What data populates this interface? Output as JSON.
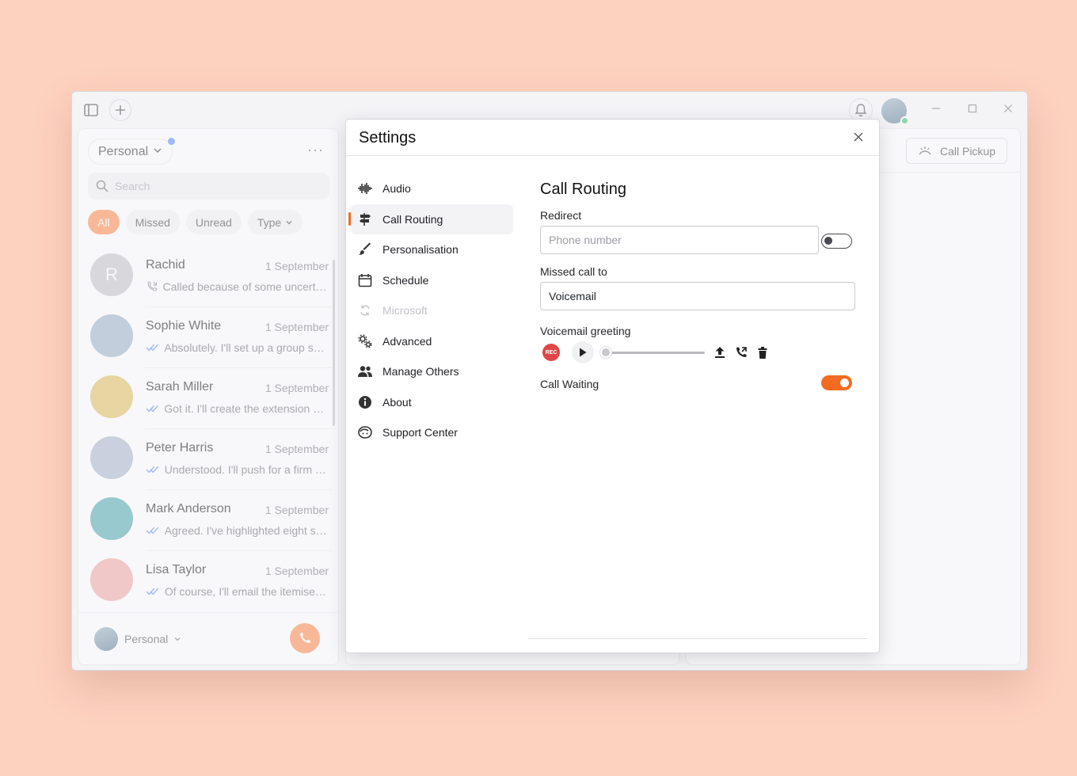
{
  "workspace": {
    "label": "Personal"
  },
  "search": {
    "placeholder": "Search"
  },
  "filters": [
    "All",
    "Missed",
    "Unread",
    "Type"
  ],
  "conversations": [
    {
      "name": "Rachid",
      "initial": "R",
      "date": "1 September",
      "preview": "Called because of some uncertai...",
      "preview_icon": "missed-call-icon",
      "avatar_color": "#c4c4c8"
    },
    {
      "name": "Sophie White",
      "date": "1 September",
      "preview": "Absolutely. I'll set up a group ses...",
      "preview_icon": "double-check-icon",
      "avatar_color": "#9fb3c8"
    },
    {
      "name": "Sarah Miller",
      "date": "1 September",
      "preview": "Got it. I'll create the extension an...",
      "preview_icon": "double-check-icon",
      "avatar_color": "#e0c060"
    },
    {
      "name": "Peter Harris",
      "date": "1 September",
      "preview": "Understood. I'll push for a firm p...",
      "preview_icon": "double-check-icon",
      "avatar_color": "#a9b8cc"
    },
    {
      "name": "Mark Anderson",
      "date": "1 September",
      "preview": "Agreed. I've highlighted eight se...",
      "preview_icon": "double-check-icon",
      "avatar_color": "#4faab0"
    },
    {
      "name": "Lisa Taylor",
      "date": "1 September",
      "preview": "Of course, I'll email the itemised...",
      "preview_icon": "double-check-icon",
      "avatar_color": "#f0a8a4"
    }
  ],
  "bottom": {
    "account_label": "Personal"
  },
  "right": {
    "call_pickup_label": "Call Pickup"
  },
  "settings": {
    "title": "Settings",
    "nav": [
      {
        "label": "Audio",
        "icon": "audio-wave-icon",
        "state": "normal"
      },
      {
        "label": "Call Routing",
        "icon": "signpost-icon",
        "state": "active"
      },
      {
        "label": "Personalisation",
        "icon": "brush-icon",
        "state": "normal"
      },
      {
        "label": "Schedule",
        "icon": "calendar-icon",
        "state": "normal"
      },
      {
        "label": "Microsoft",
        "icon": "sync-icon",
        "state": "disabled"
      },
      {
        "label": "Advanced",
        "icon": "gears-icon",
        "state": "normal"
      },
      {
        "label": "Manage Others",
        "icon": "people-icon",
        "state": "normal"
      },
      {
        "label": "About",
        "icon": "info-icon",
        "state": "normal"
      },
      {
        "label": "Support Center",
        "icon": "support-icon",
        "state": "normal"
      }
    ],
    "content": {
      "heading": "Call Routing",
      "redirect_label": "Redirect",
      "phone_placeholder": "Phone number",
      "redirect_enabled": false,
      "missed_call_label": "Missed call to",
      "missed_call_value": "Voicemail",
      "voicemail_label": "Voicemail greeting",
      "rec_label": "REC",
      "call_waiting_label": "Call Waiting",
      "call_waiting_enabled": true
    }
  },
  "colors": {
    "accent": "#f26b21",
    "chip_active": "#ff8a4c",
    "background": "#fdd2bf"
  }
}
